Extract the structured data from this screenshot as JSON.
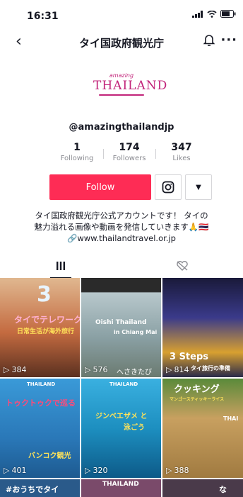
{
  "status_bar": {
    "time": "16:31"
  },
  "header": {
    "title": "タイ国政府観光庁"
  },
  "logo": {
    "top_text": "amazing",
    "main_text": "THAILAND"
  },
  "profile": {
    "handle": "@amazingthailandjp",
    "stats": [
      {
        "value": "1",
        "label": "Following"
      },
      {
        "value": "174",
        "label": "Followers"
      },
      {
        "value": "347",
        "label": "Likes"
      }
    ],
    "follow_label": "Follow",
    "bio_line1": "タイ国政府観光庁公式アカウントです！ タイの",
    "bio_line2": "魅力溢れる画像や動画を発信していきます🙏🇹🇭",
    "bio_link": "🔗www.thailandtravel.or.jp"
  },
  "videos": [
    {
      "views": "384",
      "caption1": "3",
      "caption2": "タイでテレワーク",
      "caption3": "日常生活が海外旅行",
      "bg": "#c98860"
    },
    {
      "views": "576",
      "caption1": "Oishi Thailand",
      "caption2": "in Chiang Mai",
      "caption3": "へさきたび",
      "bg": "#8fa3a8"
    },
    {
      "views": "814",
      "caption1": "3 Steps",
      "caption2": "タイ旅行の準備",
      "caption3": "",
      "bg": "#2a2f6b"
    },
    {
      "views": "401",
      "caption1": "THAILAND",
      "caption2": "トゥクトゥクで巡る",
      "caption3": "バンコク観光",
      "bg": "#2f88c8"
    },
    {
      "views": "320",
      "caption1": "THAILAND",
      "caption2": "ジンベエザメ と",
      "caption3": "泳ごう",
      "bg": "#1e8fc0"
    },
    {
      "views": "388",
      "caption1": "クッキング",
      "caption2": "マンゴースティッキーライス",
      "caption3": "THAI",
      "bg": "#9a7a3f"
    },
    {
      "views": "",
      "caption1": "#おうちでタイ",
      "caption2": "",
      "caption3": "",
      "bg": "#2a5a8a"
    },
    {
      "views": "",
      "caption1": "THAILAND",
      "caption2": "",
      "caption3": "",
      "bg": "#7a4a6a"
    },
    {
      "views": "",
      "caption1": "な",
      "caption2": "",
      "caption3": "",
      "bg": "#4a3a4a"
    }
  ]
}
